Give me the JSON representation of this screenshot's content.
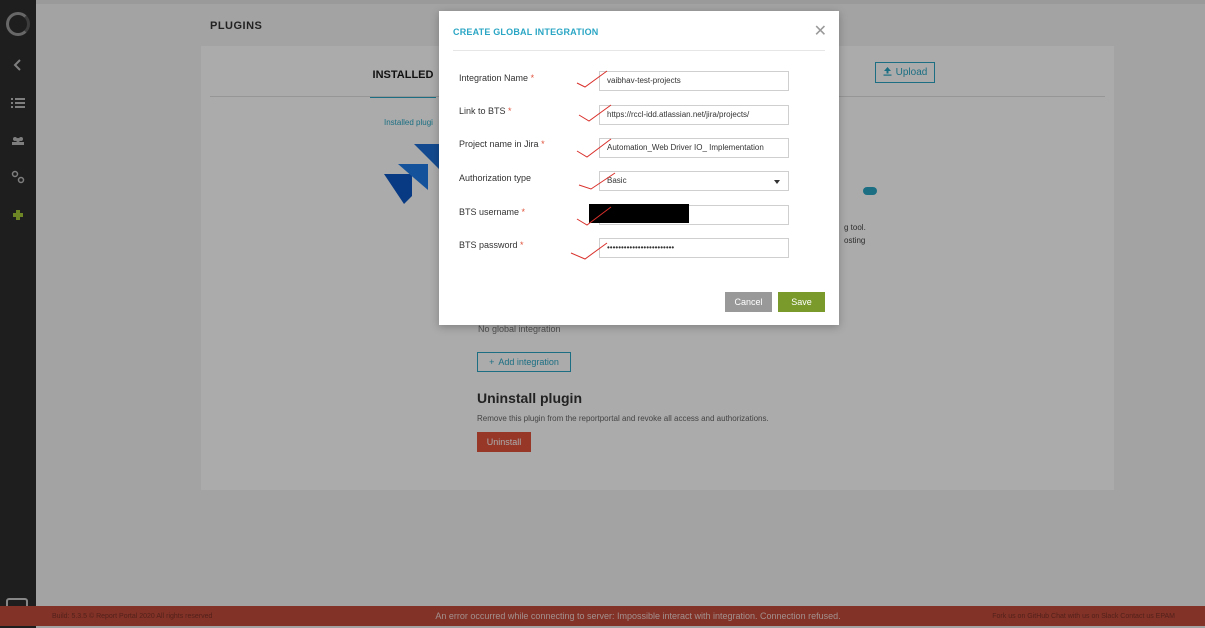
{
  "page": {
    "title": "PLUGINS",
    "tab_installed": "INSTALLED",
    "upload_label": "Upload",
    "installed_hint": "Installed plugi",
    "desc_right_1": "g tool.",
    "desc_right_2": "osting",
    "no_global": "No global integration",
    "add_integration": "Add integration",
    "uninstall_title": "Uninstall plugin",
    "uninstall_desc": "Remove this plugin from the reportportal and revoke all access and authorizations.",
    "uninstall_btn": "Uninstall"
  },
  "modal": {
    "title": "CREATE GLOBAL INTEGRATION",
    "close_icon": "close-icon",
    "fields": [
      {
        "label": "Integration Name",
        "required": "*",
        "value": "vaibhav-test-projects"
      },
      {
        "label": "Link to BTS",
        "required": "*",
        "value": "https://rccl-idd.atlassian.net/jira/projects/"
      },
      {
        "label": "Project name in Jira",
        "required": "*",
        "value": "Automation_Web Driver IO_ Implementation"
      },
      {
        "label": "Authorization type",
        "required": "",
        "value": "Basic"
      },
      {
        "label": "BTS username",
        "required": "*",
        "value": ""
      },
      {
        "label": "BTS password",
        "required": "*",
        "value": "••••••••••••••••••••••••"
      }
    ],
    "cancel_label": "Cancel",
    "save_label": "Save"
  },
  "footer": {
    "left": "Build: 5.3.5 © Report Portal 2020 All rights reserved",
    "right": "Fork us on GitHub   Chat with us on Slack   Contact us   EPAM",
    "error": "An error occurred while connecting to server: Impossible interact with integration. Connection refused."
  },
  "colors": {
    "accent": "#2aa6c4",
    "save": "#7a9b2b",
    "danger": "#e0533d",
    "sidebar": "#2d2d2d",
    "error_bar": "#c24b3b"
  }
}
